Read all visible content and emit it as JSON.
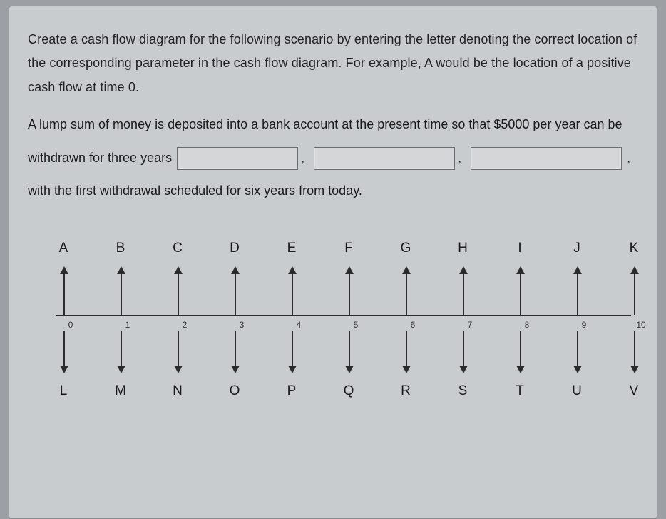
{
  "question": {
    "para1": "Create a cash flow diagram for the following scenario by entering the letter denoting the correct location of the corresponding parameter in the cash flow diagram.  For example, A would be the location of a positive cash flow at time 0.",
    "seg1": "A lump sum of money is deposited into a bank account at the present time so that $5000 per year can be withdrawn for three years ",
    "seg2": ", with the first withdrawal scheduled for six years from today."
  },
  "diagram": {
    "points": [
      {
        "x": 0,
        "num": "0",
        "top": "A",
        "bot": "L"
      },
      {
        "x": 1,
        "num": "1",
        "top": "B",
        "bot": "M"
      },
      {
        "x": 2,
        "num": "2",
        "top": "C",
        "bot": "N"
      },
      {
        "x": 3,
        "num": "3",
        "top": "D",
        "bot": "O"
      },
      {
        "x": 4,
        "num": "4",
        "top": "E",
        "bot": "P"
      },
      {
        "x": 5,
        "num": "5",
        "top": "F",
        "bot": "Q"
      },
      {
        "x": 6,
        "num": "6",
        "top": "G",
        "bot": "R"
      },
      {
        "x": 7,
        "num": "7",
        "top": "H",
        "bot": "S"
      },
      {
        "x": 8,
        "num": "8",
        "top": "I",
        "bot": "T"
      },
      {
        "x": 9,
        "num": "9",
        "top": "J",
        "bot": "U"
      },
      {
        "x": 10,
        "num": "10",
        "top": "K",
        "bot": "V"
      }
    ]
  }
}
